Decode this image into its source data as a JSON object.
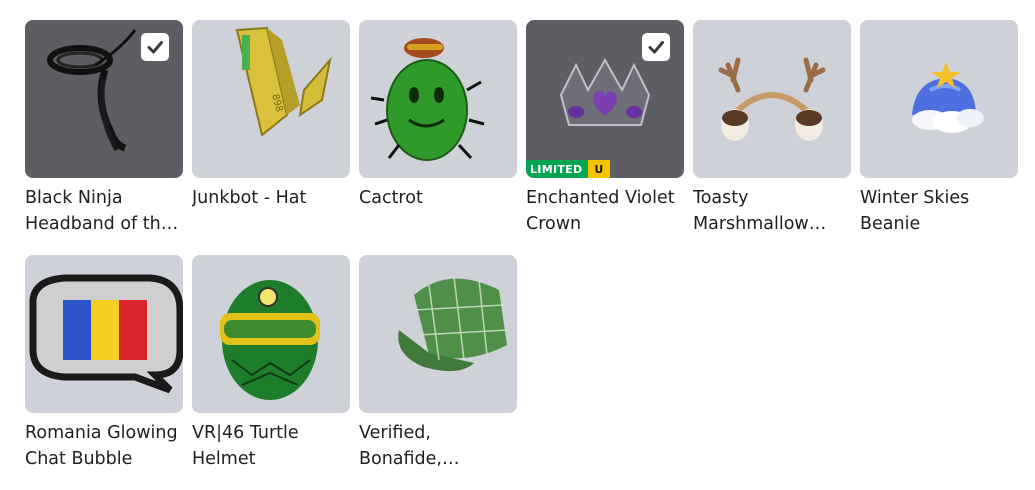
{
  "items": [
    {
      "name": "Black Ninja Headband of the Ancients",
      "selected": true,
      "limited": false
    },
    {
      "name": "Junkbot - Hat",
      "selected": false,
      "limited": false
    },
    {
      "name": "Cactrot",
      "selected": false,
      "limited": false
    },
    {
      "name": "Enchanted Violet Crown",
      "selected": true,
      "limited": true,
      "limited_label": "LIMITED",
      "limited_suffix": "U"
    },
    {
      "name": "Toasty Marshmallow Earmuffs",
      "selected": false,
      "limited": false
    },
    {
      "name": "Winter Skies Beanie",
      "selected": false,
      "limited": false
    },
    {
      "name": "Romania Glowing Chat Bubble",
      "selected": false,
      "limited": false
    },
    {
      "name": "VR|46 Turtle Helmet",
      "selected": false,
      "limited": false
    },
    {
      "name": "Verified, Bonafide, Plaidafied",
      "selected": false,
      "limited": false
    }
  ],
  "colors": {
    "thumb_bg": "#cfd1d8",
    "thumb_bg_dark": "#5d5e63",
    "limited_green": "#02a651",
    "limited_yellow": "#f5c400"
  }
}
